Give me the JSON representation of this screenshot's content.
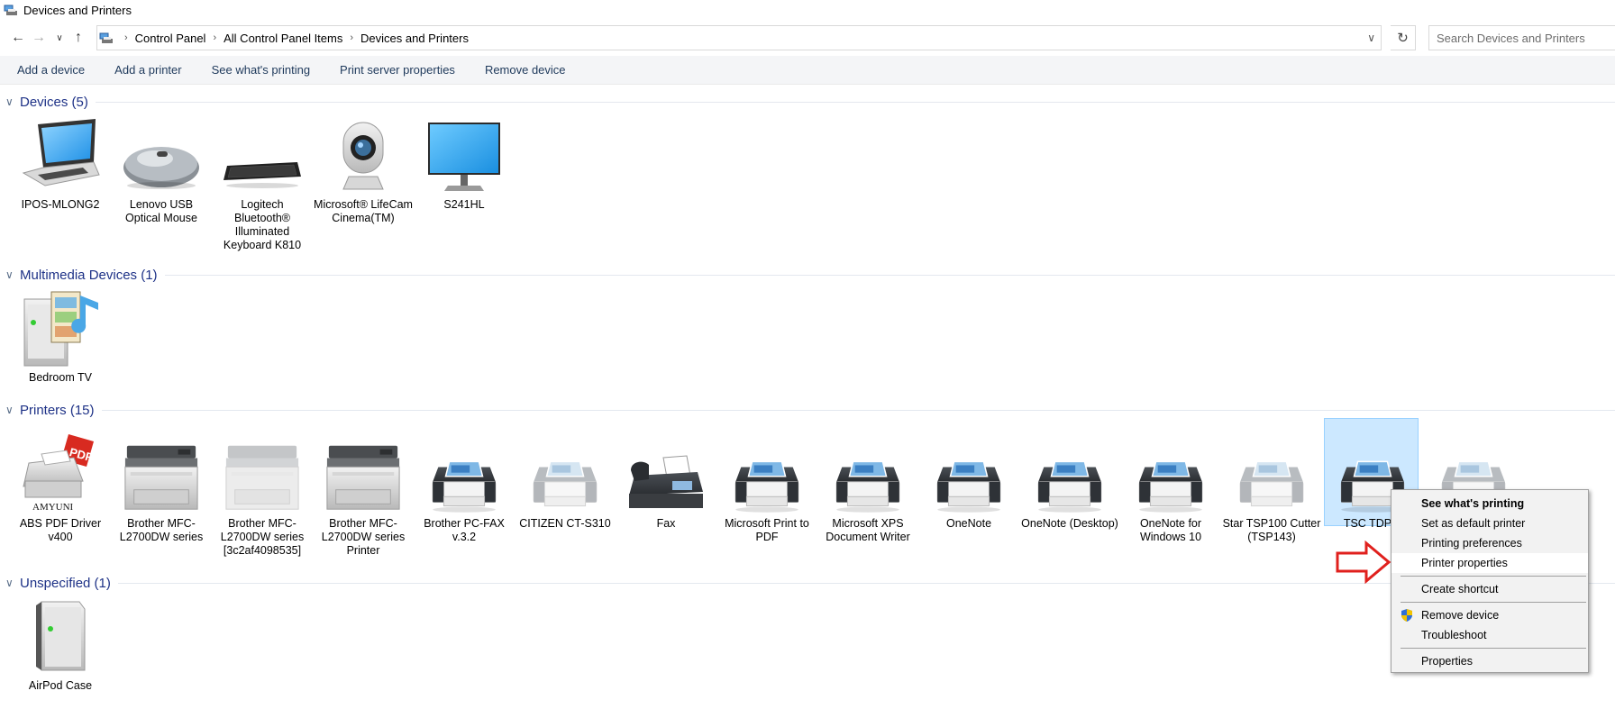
{
  "window": {
    "title": "Devices and Printers"
  },
  "address": {
    "crumbs": [
      "Control Panel",
      "All Control Panel Items",
      "Devices and Printers"
    ]
  },
  "search": {
    "placeholder": "Search Devices and Printers"
  },
  "toolbar": {
    "add_device": "Add a device",
    "add_printer": "Add a printer",
    "see_printing": "See what's printing",
    "print_server": "Print server properties",
    "remove_device": "Remove device"
  },
  "groups": {
    "devices": {
      "title": "Devices (5)",
      "items": [
        {
          "label": "IPOS-MLONG2",
          "icon": "laptop-icon"
        },
        {
          "label": "Lenovo USB Optical Mouse",
          "icon": "mouse-icon"
        },
        {
          "label": "Logitech Bluetooth® Illuminated Keyboard K810",
          "icon": "keyboard-icon"
        },
        {
          "label": "Microsoft® LifeCam Cinema(TM)",
          "icon": "webcam-icon"
        },
        {
          "label": "S241HL",
          "icon": "monitor-icon"
        }
      ]
    },
    "multimedia": {
      "title": "Multimedia Devices (1)",
      "items": [
        {
          "label": "Bedroom TV",
          "icon": "media-device-icon"
        }
      ]
    },
    "printers": {
      "title": "Printers (15)",
      "items": [
        {
          "label": "ABS PDF Driver v400",
          "icon": "pdf-printer-icon",
          "brand": "AMYUNI"
        },
        {
          "label": "Brother MFC-L2700DW series",
          "icon": "mfp-printer-icon"
        },
        {
          "label": "Brother MFC-L2700DW series [3c2af4098535]",
          "icon": "mfp-printer-icon"
        },
        {
          "label": "Brother MFC-L2700DW series Printer",
          "icon": "mfp-printer-icon"
        },
        {
          "label": "Brother PC-FAX v.3.2",
          "icon": "printer-icon"
        },
        {
          "label": "CITIZEN CT-S310",
          "icon": "printer-icon"
        },
        {
          "label": "Fax",
          "icon": "fax-icon"
        },
        {
          "label": "Microsoft Print to PDF",
          "icon": "printer-icon"
        },
        {
          "label": "Microsoft XPS Document Writer",
          "icon": "printer-icon"
        },
        {
          "label": "OneNote",
          "icon": "printer-icon"
        },
        {
          "label": "OneNote (Desktop)",
          "icon": "printer-icon"
        },
        {
          "label": "OneNote for Windows 10",
          "icon": "printer-icon"
        },
        {
          "label": "Star TSP100 Cutter (TSP143)",
          "icon": "printer-icon"
        },
        {
          "label": "TSC TDP-2",
          "icon": "printer-icon"
        },
        {
          "label": "",
          "icon": "printer-icon"
        }
      ]
    },
    "unspecified": {
      "title": "Unspecified (1)",
      "items": [
        {
          "label": "AirPod Case",
          "icon": "generic-device-icon"
        }
      ]
    }
  },
  "context_menu": {
    "items": [
      "See what's printing",
      "Set as default printer",
      "Printing preferences",
      "Printer properties",
      "Create shortcut",
      "Remove device",
      "Troubleshoot",
      "Properties"
    ]
  },
  "colors": {
    "group_title": "#1e3287",
    "command_text": "#1e395b",
    "selection_fill": "#cce8ff",
    "arrow_red": "#e0201d"
  }
}
